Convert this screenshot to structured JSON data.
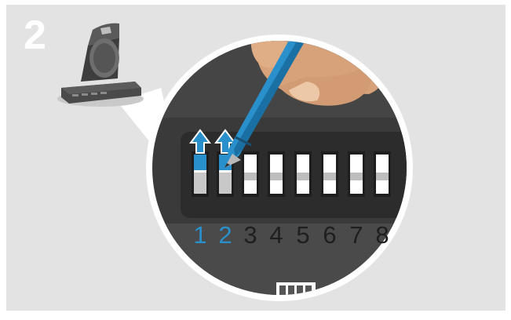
{
  "step": {
    "number": "2"
  },
  "dip_switch": {
    "labels": [
      "1",
      "2",
      "3",
      "4",
      "5",
      "6",
      "7",
      "8"
    ],
    "highlighted": [
      "1",
      "2"
    ],
    "arrow_icons": [
      "up-arrow-icon",
      "up-arrow-icon"
    ]
  },
  "colors": {
    "background": "#e3e3e3",
    "panel_dark": "#333333",
    "accent_blue": "#2a90cc",
    "label_dark": "#1f1f1f"
  }
}
